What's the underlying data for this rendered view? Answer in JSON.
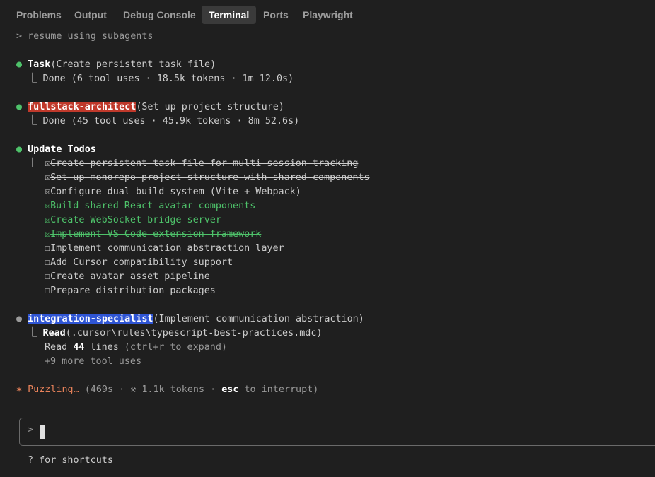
{
  "tabs": [
    "Problems",
    "Output",
    "Debug Console",
    "Terminal",
    "Ports",
    "Playwright"
  ],
  "active_tab": "Terminal",
  "command": "> resume using subagents",
  "task": {
    "bullet": "●",
    "name": "Task",
    "args": "(Create persistent task file)",
    "result": "⎿ Done (6 tool uses · 18.5k tokens · 1m 12.0s)"
  },
  "architect": {
    "bullet": "●",
    "name": "fullstack-architect",
    "args": "(Set up project structure)",
    "result": "⎿ Done (45 tool uses · 45.9k tokens · 8m 52.6s)"
  },
  "todos": {
    "bullet": "●",
    "title": "Update Todos",
    "branch": "⎿",
    "checked_box": "☒",
    "unchecked_box": "☐",
    "items": [
      {
        "text": "Create persistent task file for multi-session tracking",
        "state": "done"
      },
      {
        "text": "Set up monorepo project structure with shared components",
        "state": "done"
      },
      {
        "text": "Configure dual build system (Vite + Webpack)",
        "state": "done"
      },
      {
        "text": "Build shared React avatar components",
        "state": "done-green"
      },
      {
        "text": "Create WebSocket bridge server",
        "state": "done-green"
      },
      {
        "text": "Implement VS Code extension framework",
        "state": "done-green"
      },
      {
        "text": "Implement communication abstraction layer",
        "state": "todo"
      },
      {
        "text": "Add Cursor compatibility support",
        "state": "todo"
      },
      {
        "text": "Create avatar asset pipeline",
        "state": "todo"
      },
      {
        "text": "Prepare distribution packages",
        "state": "todo"
      }
    ]
  },
  "specialist": {
    "bullet": "●",
    "name": "integration-specialist",
    "args": "(Implement communication abstraction)",
    "branch": "⎿",
    "read_label": "Read",
    "read_args": "(.cursor\\rules\\typescript-best-practices.mdc)",
    "read_prefix": "Read ",
    "read_count": "44",
    "read_suffix": " lines",
    "expand_hint": " (ctrl+r to expand)",
    "more": "+9 more tool uses"
  },
  "status": {
    "star": "✶",
    "label": " Puzzling…",
    "detail_a": " (469s · ⚒ 1.1k tokens · ",
    "esc": "esc",
    "detail_b": " to interrupt)"
  },
  "prompt": {
    "char": ">"
  },
  "hint": "? for shortcuts",
  "colors": {
    "background": "#1f1f1f",
    "green": "#4ec26a",
    "red_tag": "#c0392b",
    "blue_tag": "#2f55d4",
    "orange": "#e8825a"
  }
}
